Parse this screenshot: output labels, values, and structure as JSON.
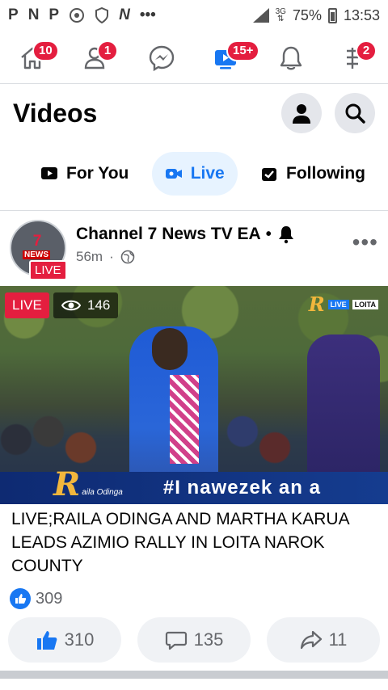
{
  "status_bar": {
    "left_icons": [
      "P",
      "N",
      "P"
    ],
    "time": "13:53",
    "battery": "75%",
    "network": "3G"
  },
  "top_nav": {
    "items": [
      {
        "name": "home-icon",
        "badge": "10"
      },
      {
        "name": "friends-icon",
        "badge": "1"
      },
      {
        "name": "messenger-icon",
        "badge": ""
      },
      {
        "name": "video-icon",
        "badge": "15+"
      },
      {
        "name": "bell-icon",
        "badge": ""
      },
      {
        "name": "menu-icon",
        "badge": "2"
      }
    ]
  },
  "header": {
    "title": "Videos"
  },
  "tabs": [
    {
      "label": "For You",
      "active": false
    },
    {
      "label": "Live",
      "active": true
    },
    {
      "label": "Following",
      "active": false
    }
  ],
  "post": {
    "channel": "Channel 7 News TV EA",
    "time": "56m",
    "avatar_news": "NEWS",
    "avatar_live": "LIVE",
    "video": {
      "live_label": "LIVE",
      "viewers": "146",
      "watermark_live": "LIVE",
      "watermark_place": "LOITA",
      "lower_name": "aila Odinga",
      "hashtag": "#I nawezek an a"
    },
    "caption": "LIVE;RAILA ODINGA AND MARTHA KARUA LEADS AZIMIO RALLY IN LOITA NAROK COUNTY",
    "reaction_count": "309",
    "actions": {
      "likes": "310",
      "comments": "135",
      "shares": "11"
    }
  },
  "colors": {
    "accent": "#1877f2",
    "badge": "#e41e3f"
  }
}
